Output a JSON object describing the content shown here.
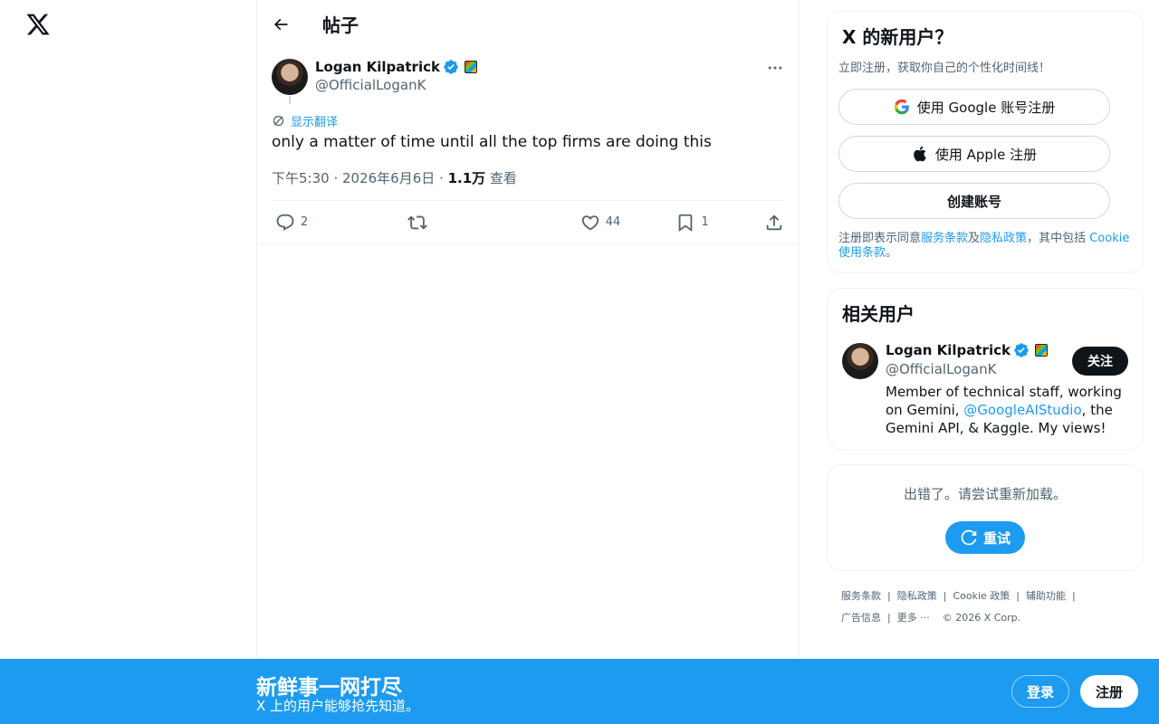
{
  "header": {
    "title": "帖子"
  },
  "tweet": {
    "author_name": "Logan Kilpatrick",
    "author_handle": "@OfficialLoganK",
    "translate_label": "显示翻译",
    "text": "only a matter of time until all the top firms are doing this",
    "time": "下午5:30 · 2026年6月6日 · ",
    "views_count": "1.1万",
    "views_label": " 查看",
    "replies": "2",
    "retweets": "",
    "likes": "44",
    "bookmarks": "1"
  },
  "signup_card": {
    "title": "X 的新用户？",
    "subtitle": "立即注册，获取你自己的个性化时间线！",
    "google_label": "使用 Google 账号注册",
    "apple_label": "使用 Apple 注册",
    "create_label": "创建账号",
    "legal_prefix": "注册即表示同意",
    "terms": "服务条款",
    "and": "及",
    "privacy": "隐私政策",
    "including": "，其中包括 ",
    "cookie": "Cookie 使用条款",
    "period": "。"
  },
  "related": {
    "title": "相关用户",
    "name": "Logan Kilpatrick",
    "handle": "@OfficialLoganK",
    "follow_label": "关注",
    "bio_before": "Member of technical staff, working on Gemini, ",
    "bio_link": "@GoogleAIStudio",
    "bio_after": ", the Gemini API, & Kaggle. My views!"
  },
  "error_card": {
    "message": "出错了。请尝试重新加载。",
    "retry_label": "重试"
  },
  "footer": {
    "terms": "服务条款",
    "privacy": "隐私政策",
    "cookie": "Cookie 政策",
    "accessibility": "辅助功能",
    "ads": "广告信息",
    "more": "更多 ···",
    "copyright": "© 2026 X Corp."
  },
  "banner": {
    "title": "新鲜事一网打尽",
    "subtitle": "X 上的用户能够抢先知道。",
    "login_label": "登录",
    "signup_label": "注册"
  },
  "colors": {
    "accent": "#1d9bf0",
    "text": "#0f1419",
    "muted": "#536471",
    "border": "#eff3f4"
  }
}
